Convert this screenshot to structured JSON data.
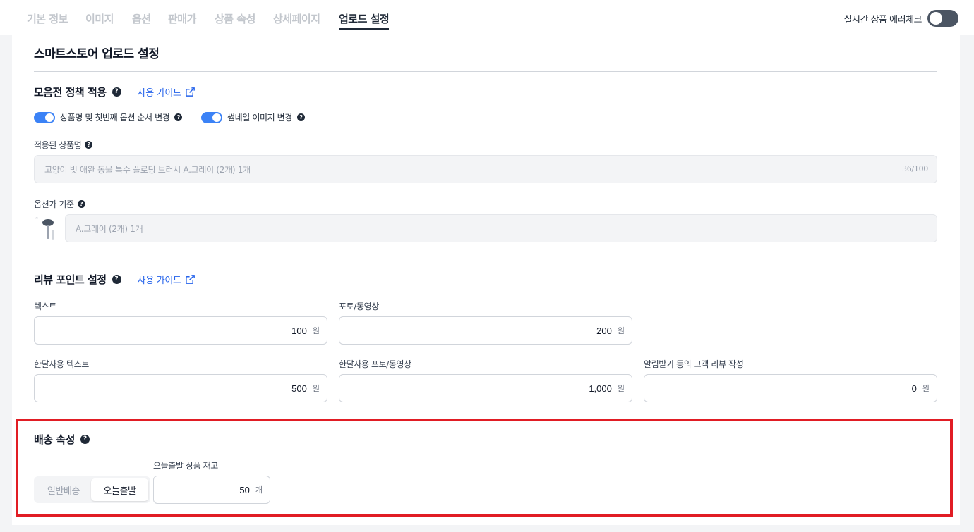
{
  "tabs": [
    {
      "label": "기본 정보"
    },
    {
      "label": "이미지"
    },
    {
      "label": "옵션"
    },
    {
      "label": "판매가"
    },
    {
      "label": "상품 속성"
    },
    {
      "label": "상세페이지"
    },
    {
      "label": "업로드 설정"
    }
  ],
  "active_tab": "업로드 설정",
  "realtime_check": {
    "label": "실시간 상품 에러체크",
    "enabled": false
  },
  "page_title": "스마트스토어 업로드 설정",
  "policy": {
    "title": "모음전 정책 적용",
    "guide_label": "사용 가이드",
    "toggles": [
      {
        "label": "상품명 및 첫번째 옵션 순서 변경",
        "enabled": true
      },
      {
        "label": "썸네일 이미지 변경",
        "enabled": true
      }
    ],
    "applied_name_label": "적용된 상품명",
    "applied_name_value": "고양이 빗 애완 동물 특수 플로팅 브러시 A.그레이 (2개) 1개",
    "applied_name_counter": "36/100",
    "option_price_label": "옵션가 기준",
    "option_price_value": "A.그레이 (2개) 1개",
    "thumbnail_icon": "pet-brush-thumbnail"
  },
  "review": {
    "title": "리뷰 포인트 설정",
    "guide_label": "사용 가이드",
    "fields": [
      {
        "label": "텍스트",
        "value": "100",
        "unit": "원"
      },
      {
        "label": "포토/동영상",
        "value": "200",
        "unit": "원"
      },
      {
        "label": "한달사용 텍스트",
        "value": "500",
        "unit": "원"
      },
      {
        "label": "한달사용 포토/동영상",
        "value": "1,000",
        "unit": "원"
      },
      {
        "label": "알림받기 동의 고객 리뷰 작성",
        "value": "0",
        "unit": "원"
      }
    ]
  },
  "shipping": {
    "title": "배송 속성",
    "options": [
      "일반배송",
      "오늘출발"
    ],
    "selected": "오늘출발",
    "stock_label": "오늘출발 상품 재고",
    "stock_value": "50",
    "stock_unit": "개"
  },
  "colors": {
    "accent": "#3b82f6",
    "link": "#2563eb",
    "highlight_border": "#e11d24"
  }
}
